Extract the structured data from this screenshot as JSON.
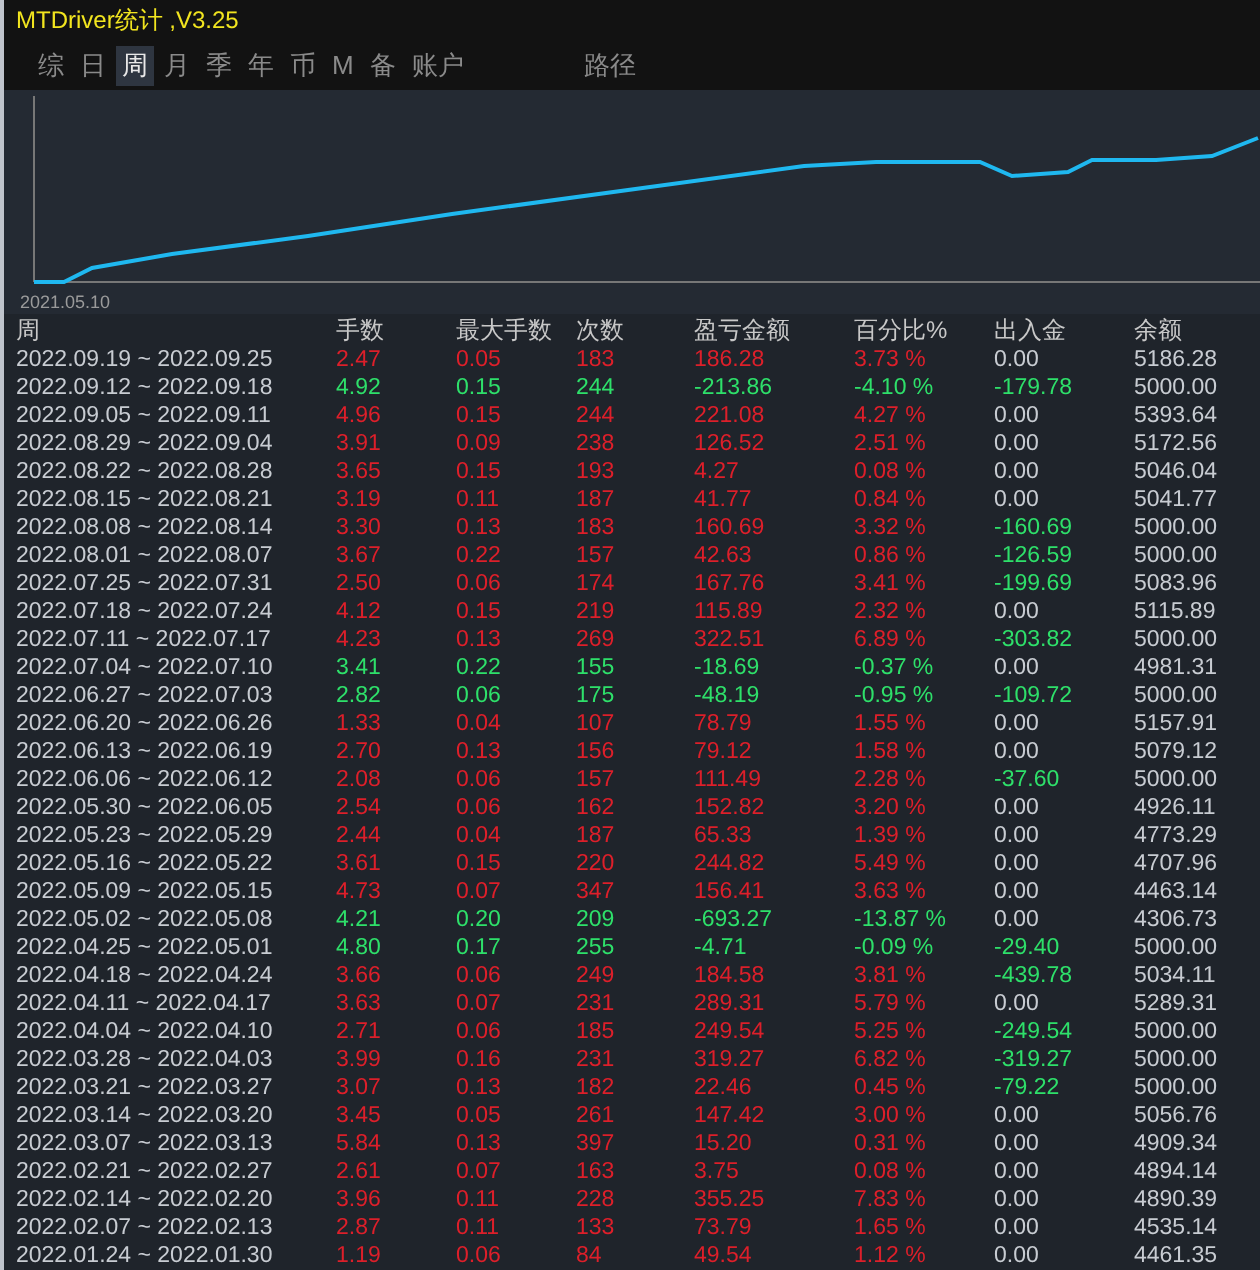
{
  "window": {
    "title": "MTDriver统计 ,V3.25"
  },
  "tabs": [
    {
      "label": "综",
      "selected": false
    },
    {
      "label": "日",
      "selected": false
    },
    {
      "label": "周",
      "selected": true
    },
    {
      "label": "月",
      "selected": false
    },
    {
      "label": "季",
      "selected": false
    },
    {
      "label": "年",
      "selected": false
    },
    {
      "label": "币",
      "selected": false
    },
    {
      "label": "M",
      "selected": false
    },
    {
      "label": "备",
      "selected": false
    },
    {
      "label": "账户",
      "selected": false
    }
  ],
  "path_tab": {
    "label": "路径"
  },
  "chart": {
    "start_label": "2021.05.10"
  },
  "table": {
    "columns": [
      "周",
      "手数",
      "最大手数",
      "次数",
      "盈亏金额",
      "百分比%",
      "出入金",
      "余额"
    ],
    "rows": [
      {
        "color": "#dd1f2a",
        "cash_out": false,
        "cells": [
          "2022.09.19 ~ 2022.09.25",
          "2.47",
          "0.05",
          "183",
          "186.28",
          "3.73 %",
          "0.00",
          "5186.28"
        ]
      },
      {
        "color": "#2ee06a",
        "cash_out": true,
        "cells": [
          "2022.09.12 ~ 2022.09.18",
          "4.92",
          "0.15",
          "244",
          "-213.86",
          "-4.10 %",
          "-179.78",
          "5000.00"
        ]
      },
      {
        "color": "#dd1f2a",
        "cash_out": false,
        "cells": [
          "2022.09.05 ~ 2022.09.11",
          "4.96",
          "0.15",
          "244",
          "221.08",
          "4.27 %",
          "0.00",
          "5393.64"
        ]
      },
      {
        "color": "#dd1f2a",
        "cash_out": false,
        "cells": [
          "2022.08.29 ~ 2022.09.04",
          "3.91",
          "0.09",
          "238",
          "126.52",
          "2.51 %",
          "0.00",
          "5172.56"
        ]
      },
      {
        "color": "#dd1f2a",
        "cash_out": false,
        "cells": [
          "2022.08.22 ~ 2022.08.28",
          "3.65",
          "0.15",
          "193",
          "4.27",
          "0.08 %",
          "0.00",
          "5046.04"
        ]
      },
      {
        "color": "#dd1f2a",
        "cash_out": false,
        "cells": [
          "2022.08.15 ~ 2022.08.21",
          "3.19",
          "0.11",
          "187",
          "41.77",
          "0.84 %",
          "0.00",
          "5041.77"
        ]
      },
      {
        "color": "#dd1f2a",
        "cash_out": true,
        "cells": [
          "2022.08.08 ~ 2022.08.14",
          "3.30",
          "0.13",
          "183",
          "160.69",
          "3.32 %",
          "-160.69",
          "5000.00"
        ]
      },
      {
        "color": "#dd1f2a",
        "cash_out": true,
        "cells": [
          "2022.08.01 ~ 2022.08.07",
          "3.67",
          "0.22",
          "157",
          "42.63",
          "0.86 %",
          "-126.59",
          "5000.00"
        ]
      },
      {
        "color": "#dd1f2a",
        "cash_out": true,
        "cells": [
          "2022.07.25 ~ 2022.07.31",
          "2.50",
          "0.06",
          "174",
          "167.76",
          "3.41 %",
          "-199.69",
          "5083.96"
        ]
      },
      {
        "color": "#dd1f2a",
        "cash_out": false,
        "cells": [
          "2022.07.18 ~ 2022.07.24",
          "4.12",
          "0.15",
          "219",
          "115.89",
          "2.32 %",
          "0.00",
          "5115.89"
        ]
      },
      {
        "color": "#dd1f2a",
        "cash_out": true,
        "cells": [
          "2022.07.11 ~ 2022.07.17",
          "4.23",
          "0.13",
          "269",
          "322.51",
          "6.89 %",
          "-303.82",
          "5000.00"
        ]
      },
      {
        "color": "#2ee06a",
        "cash_out": false,
        "cells": [
          "2022.07.04 ~ 2022.07.10",
          "3.41",
          "0.22",
          "155",
          "-18.69",
          "-0.37 %",
          "0.00",
          "4981.31"
        ]
      },
      {
        "color": "#2ee06a",
        "cash_out": true,
        "cells": [
          "2022.06.27 ~ 2022.07.03",
          "2.82",
          "0.06",
          "175",
          "-48.19",
          "-0.95 %",
          "-109.72",
          "5000.00"
        ]
      },
      {
        "color": "#dd1f2a",
        "cash_out": false,
        "cells": [
          "2022.06.20 ~ 2022.06.26",
          "1.33",
          "0.04",
          "107",
          "78.79",
          "1.55 %",
          "0.00",
          "5157.91"
        ]
      },
      {
        "color": "#dd1f2a",
        "cash_out": false,
        "cells": [
          "2022.06.13 ~ 2022.06.19",
          "2.70",
          "0.13",
          "156",
          "79.12",
          "1.58 %",
          "0.00",
          "5079.12"
        ]
      },
      {
        "color": "#dd1f2a",
        "cash_out": true,
        "cells": [
          "2022.06.06 ~ 2022.06.12",
          "2.08",
          "0.06",
          "157",
          "111.49",
          "2.28 %",
          "-37.60",
          "5000.00"
        ]
      },
      {
        "color": "#dd1f2a",
        "cash_out": false,
        "cells": [
          "2022.05.30 ~ 2022.06.05",
          "2.54",
          "0.06",
          "162",
          "152.82",
          "3.20 %",
          "0.00",
          "4926.11"
        ]
      },
      {
        "color": "#dd1f2a",
        "cash_out": false,
        "cells": [
          "2022.05.23 ~ 2022.05.29",
          "2.44",
          "0.04",
          "187",
          "65.33",
          "1.39 %",
          "0.00",
          "4773.29"
        ]
      },
      {
        "color": "#dd1f2a",
        "cash_out": false,
        "cells": [
          "2022.05.16 ~ 2022.05.22",
          "3.61",
          "0.15",
          "220",
          "244.82",
          "5.49 %",
          "0.00",
          "4707.96"
        ]
      },
      {
        "color": "#dd1f2a",
        "cash_out": false,
        "cells": [
          "2022.05.09 ~ 2022.05.15",
          "4.73",
          "0.07",
          "347",
          "156.41",
          "3.63 %",
          "0.00",
          "4463.14"
        ]
      },
      {
        "color": "#2ee06a",
        "cash_out": false,
        "cells": [
          "2022.05.02 ~ 2022.05.08",
          "4.21",
          "0.20",
          "209",
          "-693.27",
          "-13.87 %",
          "0.00",
          "4306.73"
        ]
      },
      {
        "color": "#2ee06a",
        "cash_out": true,
        "cells": [
          "2022.04.25 ~ 2022.05.01",
          "4.80",
          "0.17",
          "255",
          "-4.71",
          "-0.09 %",
          "-29.40",
          "5000.00"
        ]
      },
      {
        "color": "#dd1f2a",
        "cash_out": true,
        "cells": [
          "2022.04.18 ~ 2022.04.24",
          "3.66",
          "0.06",
          "249",
          "184.58",
          "3.81 %",
          "-439.78",
          "5034.11"
        ]
      },
      {
        "color": "#dd1f2a",
        "cash_out": false,
        "cells": [
          "2022.04.11 ~ 2022.04.17",
          "3.63",
          "0.07",
          "231",
          "289.31",
          "5.79 %",
          "0.00",
          "5289.31"
        ]
      },
      {
        "color": "#dd1f2a",
        "cash_out": true,
        "cells": [
          "2022.04.04 ~ 2022.04.10",
          "2.71",
          "0.06",
          "185",
          "249.54",
          "5.25 %",
          "-249.54",
          "5000.00"
        ]
      },
      {
        "color": "#dd1f2a",
        "cash_out": true,
        "cells": [
          "2022.03.28 ~ 2022.04.03",
          "3.99",
          "0.16",
          "231",
          "319.27",
          "6.82 %",
          "-319.27",
          "5000.00"
        ]
      },
      {
        "color": "#dd1f2a",
        "cash_out": true,
        "cells": [
          "2022.03.21 ~ 2022.03.27",
          "3.07",
          "0.13",
          "182",
          "22.46",
          "0.45 %",
          "-79.22",
          "5000.00"
        ]
      },
      {
        "color": "#dd1f2a",
        "cash_out": false,
        "cells": [
          "2022.03.14 ~ 2022.03.20",
          "3.45",
          "0.05",
          "261",
          "147.42",
          "3.00 %",
          "0.00",
          "5056.76"
        ]
      },
      {
        "color": "#dd1f2a",
        "cash_out": false,
        "cells": [
          "2022.03.07 ~ 2022.03.13",
          "5.84",
          "0.13",
          "397",
          "15.20",
          "0.31 %",
          "0.00",
          "4909.34"
        ]
      },
      {
        "color": "#dd1f2a",
        "cash_out": false,
        "cells": [
          "2022.02.21 ~ 2022.02.27",
          "2.61",
          "0.07",
          "163",
          "3.75",
          "0.08 %",
          "0.00",
          "4894.14"
        ]
      },
      {
        "color": "#dd1f2a",
        "cash_out": false,
        "cells": [
          "2022.02.14 ~ 2022.02.20",
          "3.96",
          "0.11",
          "228",
          "355.25",
          "7.83 %",
          "0.00",
          "4890.39"
        ]
      },
      {
        "color": "#dd1f2a",
        "cash_out": false,
        "cells": [
          "2022.02.07 ~ 2022.02.13",
          "2.87",
          "0.11",
          "133",
          "73.79",
          "1.65 %",
          "0.00",
          "4535.14"
        ]
      },
      {
        "color": "#dd1f2a",
        "cash_out": false,
        "cells": [
          "2022.01.24 ~ 2022.01.30",
          "1.19",
          "0.06",
          "84",
          "49.54",
          "1.12 %",
          "0.00",
          "4461.35"
        ]
      }
    ]
  }
}
